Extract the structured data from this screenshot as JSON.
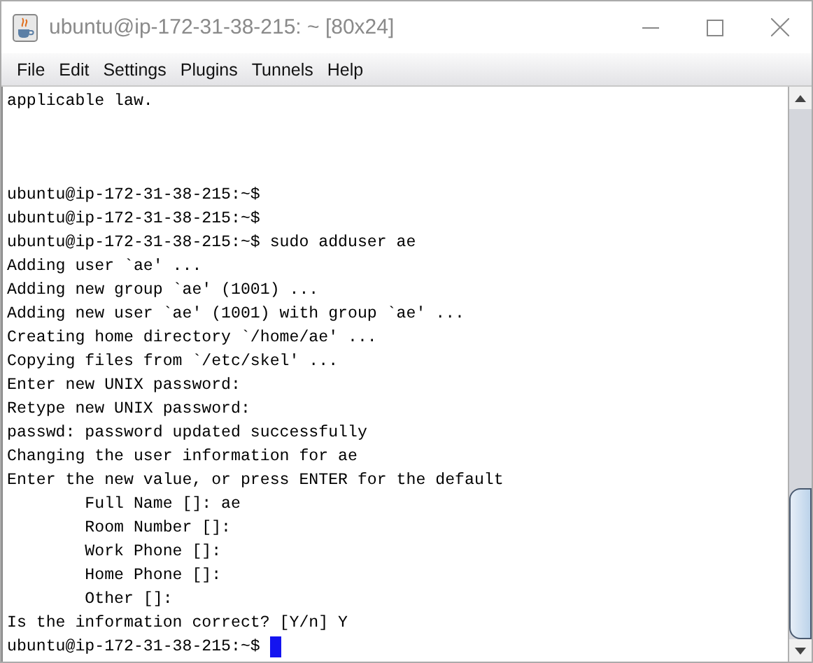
{
  "window": {
    "title": "ubuntu@ip-172-31-38-215: ~ [80x24]"
  },
  "menu": [
    "File",
    "Edit",
    "Settings",
    "Plugins",
    "Tunnels",
    "Help"
  ],
  "terminal": {
    "top_lines": [
      "applicable law."
    ],
    "lines": [
      {
        "text": "ubuntu@ip-172-31-38-215:~$",
        "cursor": false
      },
      {
        "text": "ubuntu@ip-172-31-38-215:~$",
        "cursor": false
      },
      {
        "text": "ubuntu@ip-172-31-38-215:~$ sudo adduser ae",
        "cursor": false
      },
      {
        "text": "Adding user `ae' ...",
        "cursor": false
      },
      {
        "text": "Adding new group `ae' (1001) ...",
        "cursor": false
      },
      {
        "text": "Adding new user `ae' (1001) with group `ae' ...",
        "cursor": false
      },
      {
        "text": "Creating home directory `/home/ae' ...",
        "cursor": false
      },
      {
        "text": "Copying files from `/etc/skel' ...",
        "cursor": false
      },
      {
        "text": "Enter new UNIX password:",
        "cursor": false
      },
      {
        "text": "Retype new UNIX password:",
        "cursor": false
      },
      {
        "text": "passwd: password updated successfully",
        "cursor": false
      },
      {
        "text": "Changing the user information for ae",
        "cursor": false
      },
      {
        "text": "Enter the new value, or press ENTER for the default",
        "cursor": false
      },
      {
        "text": "        Full Name []: ae",
        "cursor": false
      },
      {
        "text": "        Room Number []:",
        "cursor": false
      },
      {
        "text": "        Work Phone []:",
        "cursor": false
      },
      {
        "text": "        Home Phone []:",
        "cursor": false
      },
      {
        "text": "        Other []:",
        "cursor": false
      },
      {
        "text": "Is the information correct? [Y/n] Y",
        "cursor": false
      },
      {
        "text": "ubuntu@ip-172-31-38-215:~$ ",
        "cursor": true
      }
    ]
  }
}
